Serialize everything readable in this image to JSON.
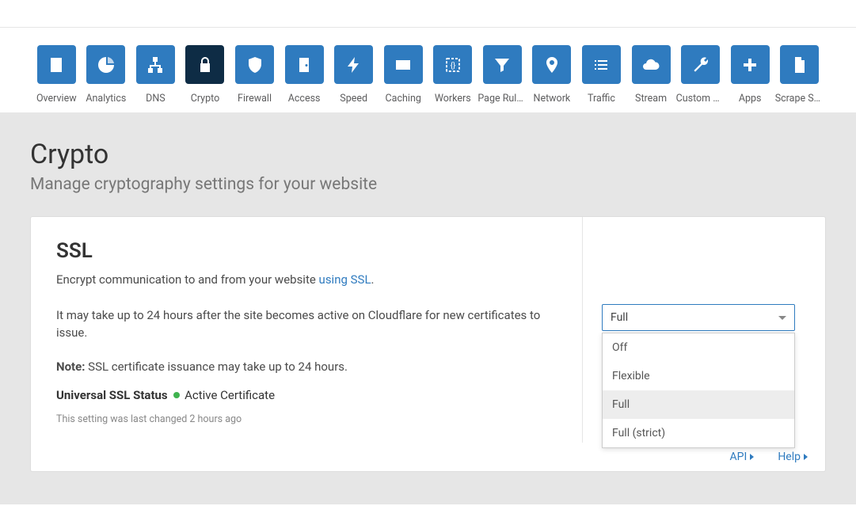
{
  "nav": {
    "items": [
      {
        "label": "Overview",
        "icon": "doc-list",
        "active": false
      },
      {
        "label": "Analytics",
        "icon": "pie",
        "active": false
      },
      {
        "label": "DNS",
        "icon": "tree",
        "active": false
      },
      {
        "label": "Crypto",
        "icon": "lock",
        "active": true
      },
      {
        "label": "Firewall",
        "icon": "shield",
        "active": false
      },
      {
        "label": "Access",
        "icon": "door",
        "active": false
      },
      {
        "label": "Speed",
        "icon": "bolt",
        "active": false
      },
      {
        "label": "Caching",
        "icon": "card",
        "active": false
      },
      {
        "label": "Workers",
        "icon": "braces",
        "active": false
      },
      {
        "label": "Page Rules",
        "icon": "funnel",
        "active": false
      },
      {
        "label": "Network",
        "icon": "pin",
        "active": false
      },
      {
        "label": "Traffic",
        "icon": "list",
        "active": false
      },
      {
        "label": "Stream",
        "icon": "cloud",
        "active": false
      },
      {
        "label": "Custom Pa...",
        "icon": "wrench",
        "active": false
      },
      {
        "label": "Apps",
        "icon": "plus",
        "active": false
      },
      {
        "label": "Scrape Shi...",
        "icon": "file",
        "active": false
      }
    ]
  },
  "page": {
    "title": "Crypto",
    "subtitle": "Manage cryptography settings for your website"
  },
  "ssl": {
    "title": "SSL",
    "desc_prefix": "Encrypt communication to and from your website ",
    "desc_link": "using SSL",
    "desc_suffix": ".",
    "desc2": "It may take up to 24 hours after the site becomes active on Cloudflare for new certificates to issue.",
    "note_label": "Note:",
    "note_text": " SSL certificate issuance may take up to 24 hours.",
    "status_label": "Universal SSL Status",
    "status_value": "Active Certificate",
    "status_color": "#3fb34f",
    "changed": "This setting was last changed 2 hours ago",
    "select_value": "Full",
    "options": [
      "Off",
      "Flexible",
      "Full",
      "Full (strict)"
    ]
  },
  "footer": {
    "api": "API",
    "help": "Help"
  }
}
